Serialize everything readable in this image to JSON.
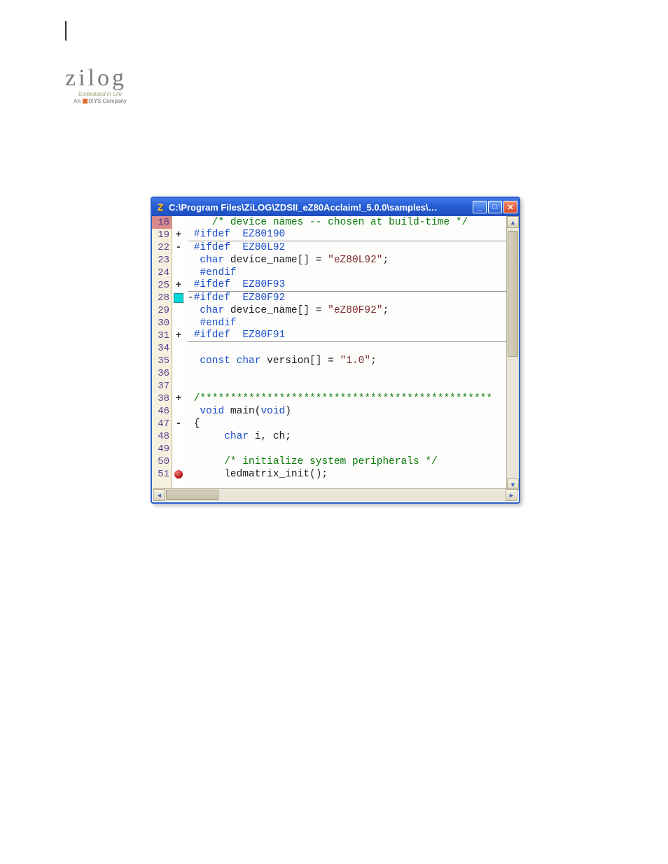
{
  "logo": {
    "word": "zilog",
    "tagline1": "Embedded in Life",
    "tagline2_prefix": "An",
    "tagline2_brand": "IXYS",
    "tagline2_suffix": "Company"
  },
  "window": {
    "title": "C:\\Program Files\\ZiLOG\\ZDSII_eZ80Acclaim!_5.0.0\\samples\\…",
    "minimize": "min",
    "maximize": "max",
    "close": "close"
  },
  "code_lines": [
    {
      "n": 18,
      "sym": "",
      "tokens": [
        [
          " ",
          "p"
        ],
        [
          "   /* device names -- chosen at build-time */",
          "c"
        ]
      ]
    },
    {
      "n": 19,
      "sym": "+",
      "tokens": [
        [
          " ",
          "p"
        ],
        [
          "#ifdef  EZ80190",
          "pre"
        ]
      ],
      "rule": true
    },
    {
      "n": 22,
      "sym": "-",
      "tokens": [
        [
          " ",
          "p"
        ],
        [
          "#ifdef  EZ80L92",
          "pre"
        ]
      ]
    },
    {
      "n": 23,
      "sym": "",
      "tokens": [
        [
          "  ",
          "p"
        ],
        [
          "char",
          "kw"
        ],
        [
          " device_name[] = ",
          "p"
        ],
        [
          "\"eZ80L92\"",
          "str"
        ],
        [
          ";",
          "p"
        ]
      ]
    },
    {
      "n": 24,
      "sym": "",
      "tokens": [
        [
          "  ",
          "p"
        ],
        [
          "#endif",
          "pre"
        ]
      ]
    },
    {
      "n": 25,
      "sym": "+",
      "tokens": [
        [
          " ",
          "p"
        ],
        [
          "#ifdef  EZ80F93",
          "pre"
        ]
      ],
      "rule": true
    },
    {
      "n": 28,
      "sym": "pc",
      "tokens": [
        [
          "-",
          "p"
        ],
        [
          "#ifdef  EZ80F92",
          "pre"
        ]
      ]
    },
    {
      "n": 29,
      "sym": "",
      "tokens": [
        [
          "  ",
          "p"
        ],
        [
          "char",
          "kw"
        ],
        [
          " device_name[] = ",
          "p"
        ],
        [
          "\"eZ80F92\"",
          "str"
        ],
        [
          ";",
          "p"
        ]
      ]
    },
    {
      "n": 30,
      "sym": "",
      "tokens": [
        [
          "  ",
          "p"
        ],
        [
          "#endif",
          "pre"
        ]
      ]
    },
    {
      "n": 31,
      "sym": "+",
      "tokens": [
        [
          " ",
          "p"
        ],
        [
          "#ifdef  EZ80F91",
          "pre"
        ]
      ],
      "rule": true
    },
    {
      "n": 34,
      "sym": "",
      "tokens": [
        [
          "",
          "p"
        ]
      ]
    },
    {
      "n": 35,
      "sym": "",
      "tokens": [
        [
          "  ",
          "p"
        ],
        [
          "const",
          "kw"
        ],
        [
          " ",
          "p"
        ],
        [
          "char",
          "kw"
        ],
        [
          " version[] = ",
          "p"
        ],
        [
          "\"1.0\"",
          "str"
        ],
        [
          ";",
          "p"
        ]
      ]
    },
    {
      "n": 36,
      "sym": "",
      "tokens": [
        [
          "",
          "p"
        ]
      ]
    },
    {
      "n": 37,
      "sym": "",
      "tokens": [
        [
          "",
          "p"
        ]
      ]
    },
    {
      "n": 38,
      "sym": "+",
      "tokens": [
        [
          " ",
          "p"
        ],
        [
          "/************************************************",
          "c"
        ]
      ]
    },
    {
      "n": 46,
      "sym": "",
      "tokens": [
        [
          "  ",
          "p"
        ],
        [
          "void",
          "kw"
        ],
        [
          " main(",
          "p"
        ],
        [
          "void",
          "kw"
        ],
        [
          ")",
          "p"
        ]
      ]
    },
    {
      "n": 47,
      "sym": "-",
      "tokens": [
        [
          " {",
          "p"
        ]
      ]
    },
    {
      "n": 48,
      "sym": "",
      "tokens": [
        [
          "      ",
          "p"
        ],
        [
          "char",
          "kw"
        ],
        [
          " i, ch;",
          "p"
        ]
      ]
    },
    {
      "n": 49,
      "sym": "",
      "tokens": [
        [
          "",
          "p"
        ]
      ]
    },
    {
      "n": 50,
      "sym": "",
      "tokens": [
        [
          "      ",
          "p"
        ],
        [
          "/* initialize system peripherals */",
          "c"
        ]
      ]
    },
    {
      "n": 51,
      "sym": "bp",
      "tokens": [
        [
          "      ledmatrix_init();",
          "p"
        ]
      ]
    }
  ],
  "active_line": 18
}
